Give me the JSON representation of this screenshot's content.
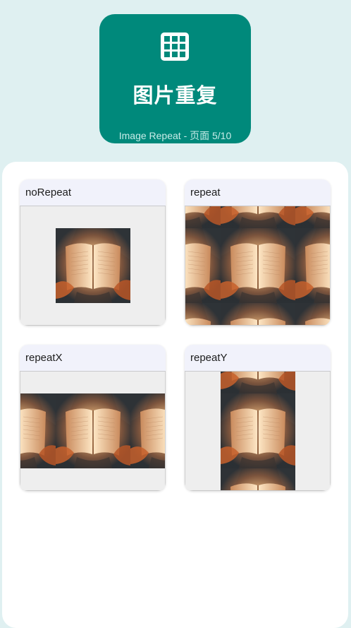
{
  "header": {
    "icon": "grid-icon",
    "title": "图片重复",
    "subtitle": "Image Repeat - 页面 5/10",
    "color": "#00897b"
  },
  "demos": [
    {
      "label": "noRepeat",
      "mode": "no-repeat"
    },
    {
      "label": "repeat",
      "mode": "repeat"
    },
    {
      "label": "repeatX",
      "mode": "repeat-x"
    },
    {
      "label": "repeatY",
      "mode": "repeat-y"
    }
  ],
  "image_subject": "open-book-in-lamplight"
}
